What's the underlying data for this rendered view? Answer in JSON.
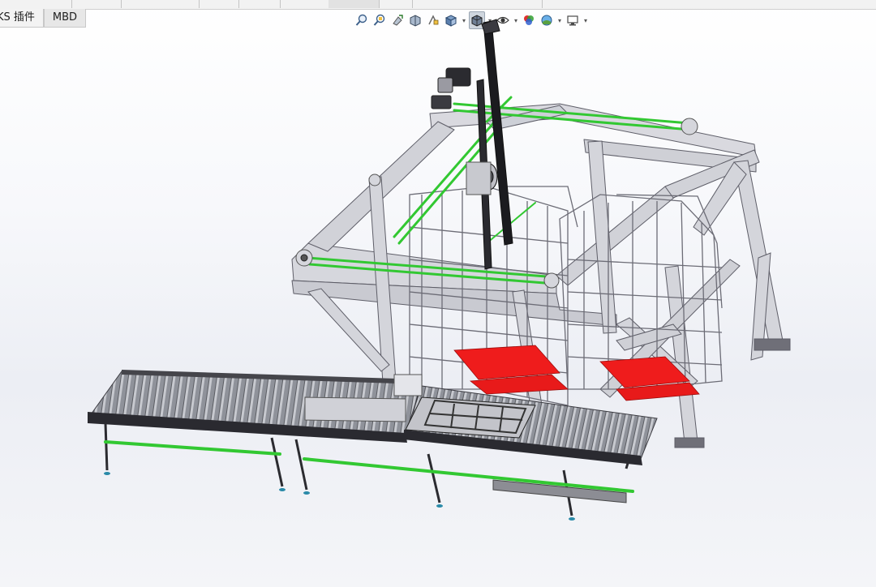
{
  "command_manager": {
    "tabs": [
      {
        "label": "KS 插件"
      },
      {
        "label": "MBD"
      }
    ]
  },
  "heads_up_toolbar": {
    "tools": [
      {
        "name": "zoom-to-fit-icon"
      },
      {
        "name": "zoom-to-area-icon"
      },
      {
        "name": "previous-view-icon"
      },
      {
        "name": "section-view-icon"
      },
      {
        "name": "dynamic-annotation-icon"
      },
      {
        "name": "view-orientation-icon"
      },
      {
        "name": "display-style-icon"
      },
      {
        "name": "hide-show-items-icon"
      },
      {
        "name": "edit-appearance-icon"
      },
      {
        "name": "apply-scene-icon"
      },
      {
        "name": "view-settings-icon"
      }
    ]
  },
  "colors": {
    "frame": "#d9d9df",
    "frame_edge": "#6e6e78",
    "belt": "#32c832",
    "roller": "#9ea0a8",
    "pallet_red": "#ef1c1c",
    "background_top": "#ffffff",
    "background_mid": "#eceef4"
  }
}
